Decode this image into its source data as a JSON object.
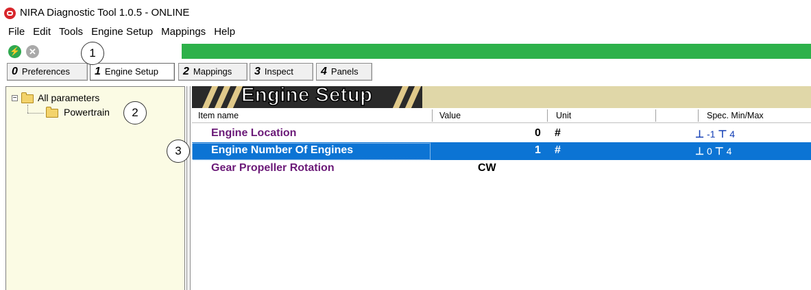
{
  "window": {
    "title": "NIRA Diagnostic Tool 1.0.5 -  ONLINE"
  },
  "menu": [
    "File",
    "Edit",
    "Tools",
    "Engine Setup",
    "Mappings",
    "Help"
  ],
  "toolbar": {
    "connect_icon": "lightning-icon",
    "stop_icon": "close-icon",
    "progress_fraction": 1.0,
    "progress_color": "#2db14a"
  },
  "callouts": [
    "1",
    "2",
    "3"
  ],
  "tabs": [
    {
      "num": "0",
      "label": "Preferences"
    },
    {
      "num": "1",
      "label": "Engine Setup",
      "active": true
    },
    {
      "num": "2",
      "label": "Mappings"
    },
    {
      "num": "3",
      "label": "Inspect"
    },
    {
      "num": "4",
      "label": "Panels"
    }
  ],
  "tree": {
    "root": "All parameters",
    "child": "Powertrain"
  },
  "banner": {
    "title": "Engine Setup"
  },
  "grid": {
    "columns": [
      "Item name",
      "Value",
      "Unit",
      "Spec. Min/Max"
    ],
    "rows": [
      {
        "name": "Engine Location",
        "value": "0",
        "unit": "#",
        "min": "-1",
        "max": "4"
      },
      {
        "name": "Engine Number Of Engines",
        "value": "1",
        "unit": "#",
        "min": "0",
        "max": "4",
        "selected": true
      },
      {
        "name": "Gear Propeller Rotation",
        "value": "CW",
        "unit": "",
        "min": "",
        "max": ""
      }
    ]
  },
  "colors": {
    "selection": "#0c74d4",
    "item_name": "#6b1a78",
    "tree_bg": "#fbfbe4",
    "banner_bg": "#e0d7a8"
  }
}
